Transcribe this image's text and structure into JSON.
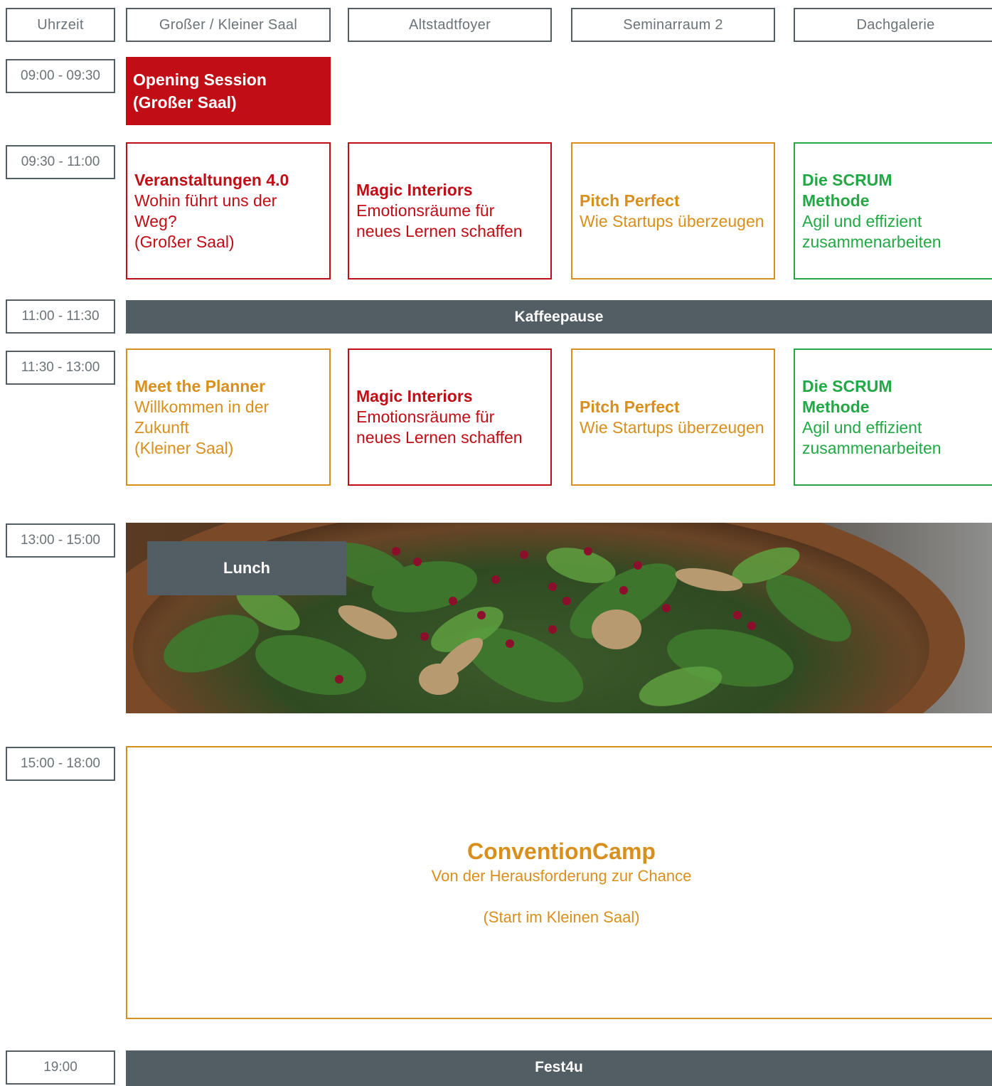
{
  "headers": [
    "Uhrzeit",
    "Großer / Kleiner Saal",
    "Altstadtfoyer",
    "Seminarraum 2",
    "Dachgalerie"
  ],
  "times": [
    "09:00 - 09:30",
    "09:30 - 11:00",
    "11:00 - 11:30",
    "11:30 - 13:00",
    "13:00 - 15:00",
    "15:00 - 18:00",
    "19:00"
  ],
  "opening": {
    "line1": "Opening Session",
    "line2": "(Großer Saal)"
  },
  "block1": [
    {
      "title": "Veranstaltungen 4.0",
      "lines": [
        "Wohin führt uns der",
        "Weg?",
        "(Großer Saal)"
      ]
    },
    {
      "title": "Magic Interiors",
      "lines": [
        "Emotionsräume für",
        "neues Lernen schaffen"
      ]
    },
    {
      "title": "Pitch Perfect",
      "lines": [
        "Wie Startups überzeugen"
      ]
    },
    {
      "title_lines": [
        "Die SCRUM",
        "Methode"
      ],
      "lines": [
        "Agil und effizient",
        "zusammenarbeiten"
      ]
    }
  ],
  "coffee": "Kaffeepause",
  "block2": [
    {
      "title": "Meet the Planner",
      "lines": [
        "Willkommen in der",
        "Zukunft",
        "(Kleiner Saal)"
      ]
    },
    {
      "title": "Magic Interiors",
      "lines": [
        "Emotionsräume für",
        "neues Lernen schaffen"
      ]
    },
    {
      "title": "Pitch Perfect",
      "lines": [
        "Wie Startups überzeugen"
      ]
    },
    {
      "title_lines": [
        "Die SCRUM",
        "Methode"
      ],
      "lines": [
        "Agil und effizient",
        "zusammenarbeiten"
      ]
    }
  ],
  "lunch": "Lunch",
  "camp": {
    "title": "ConventionCamp",
    "subtitle": "Von der Herausforderung zur Chance",
    "venue": "(Start im Kleinen Saal)"
  },
  "fest": "Fest4u",
  "colors": {
    "red": "#c00d16",
    "orange": "#d88f1d",
    "green": "#22a845",
    "slate": "#525d64"
  },
  "lunch_image_icon": "salad-bowl-photo"
}
